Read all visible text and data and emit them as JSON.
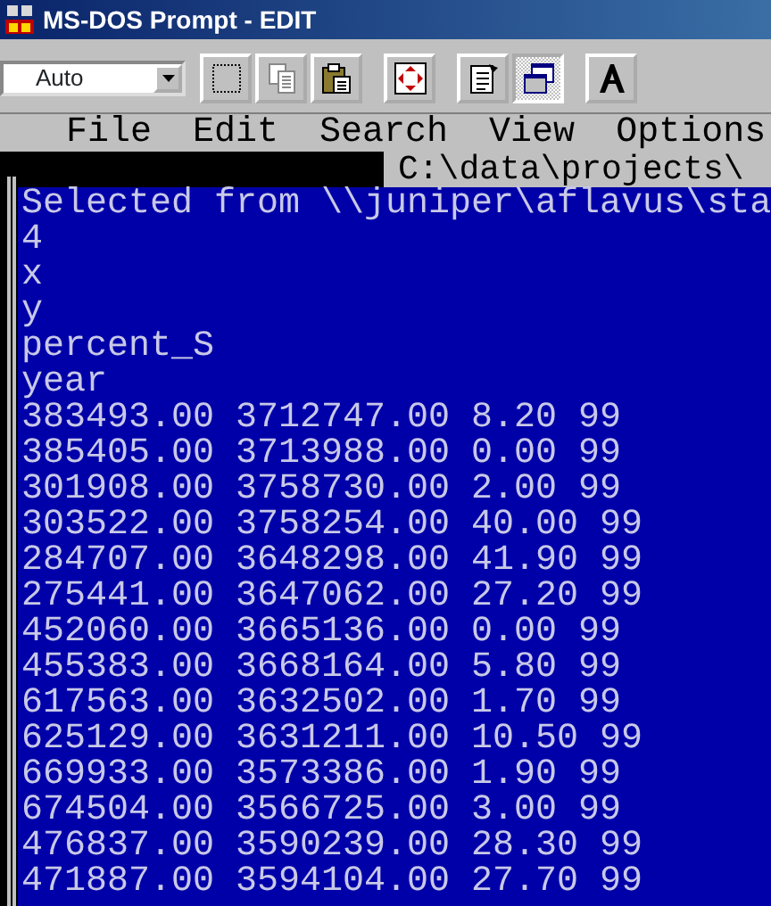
{
  "window": {
    "title": "MS-DOS Prompt - EDIT"
  },
  "toolbar": {
    "font_size": "Auto",
    "buttons": [
      {
        "kind": "mark",
        "selected": false
      },
      {
        "kind": "copy",
        "selected": false
      },
      {
        "kind": "paste",
        "selected": false
      },
      {
        "kind": "fullscreen",
        "selected": false
      },
      {
        "kind": "properties",
        "selected": false
      },
      {
        "kind": "background",
        "selected": true
      },
      {
        "kind": "font",
        "selected": false
      }
    ]
  },
  "menu": [
    "File",
    "Edit",
    "Search",
    "View",
    "Options"
  ],
  "editor": {
    "filename": "C:\\data\\projects\\",
    "lines": [
      "Selected from \\\\juniper\\aflavus\\sta",
      "4",
      "x",
      "y",
      "percent_S",
      "year",
      "383493.00 3712747.00 8.20 99",
      "385405.00 3713988.00 0.00 99",
      "301908.00 3758730.00 2.00 99",
      "303522.00 3758254.00 40.00 99",
      "284707.00 3648298.00 41.90 99",
      "275441.00 3647062.00 27.20 99",
      "452060.00 3665136.00 0.00 99",
      "455383.00 3668164.00 5.80 99",
      "617563.00 3632502.00 1.70 99",
      "625129.00 3631211.00 10.50 99",
      "669933.00 3573386.00 1.90 99",
      "674504.00 3566725.00 3.00 99",
      "476837.00 3590239.00 28.30 99",
      "471887.00 3594104.00 27.70 99"
    ]
  }
}
